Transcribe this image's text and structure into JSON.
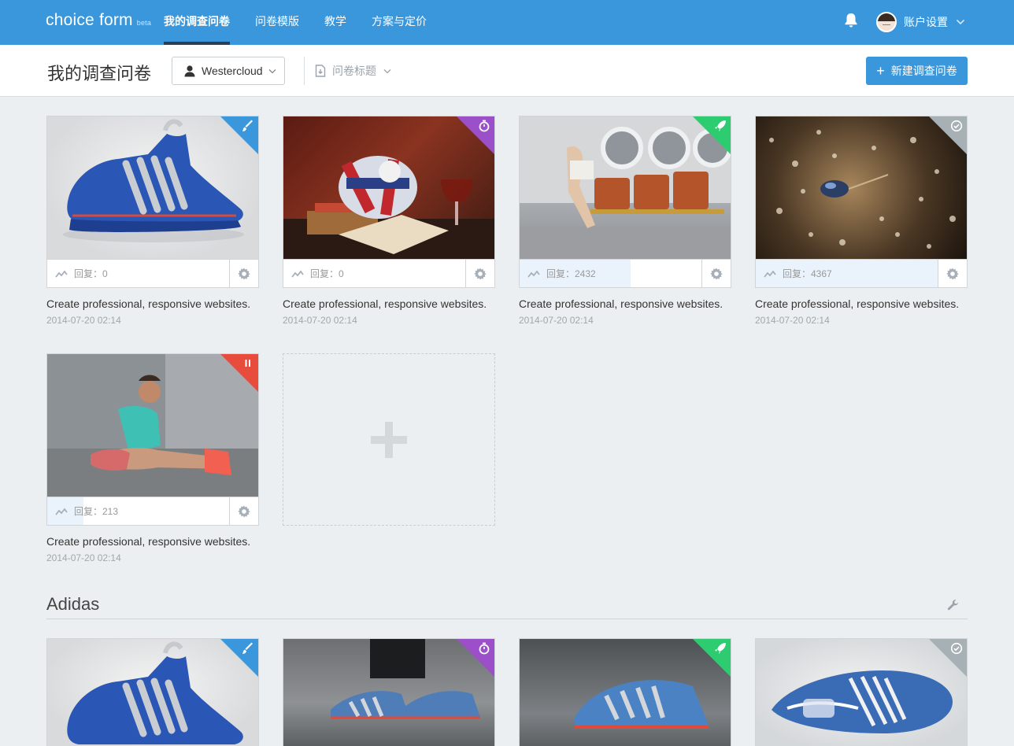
{
  "nav": {
    "logo": "choice form",
    "logo_beta": "beta",
    "items": [
      {
        "label": "我的调查问卷",
        "active": true
      },
      {
        "label": "问卷模版",
        "active": false
      },
      {
        "label": "教学",
        "active": false
      },
      {
        "label": "方案与定价",
        "active": false
      }
    ],
    "account_label": "账户设置"
  },
  "header": {
    "title": "我的调查问卷",
    "owner": "Westercloud",
    "sort_label": "问卷标题",
    "new_button": "新建调查问卷"
  },
  "colors": {
    "brand": "#3a97dc",
    "badge_blue": "#3a97dc",
    "badge_purple": "#9b4fc8",
    "badge_green": "#2ecc71",
    "badge_gray": "#a6b0b5",
    "badge_red": "#e74c3c"
  },
  "surveys": [
    {
      "title": "Create professional, responsive websites.",
      "date": "2014-07-20 02:14",
      "replies": "回复：0",
      "reply_fraction": 0,
      "status_icon": "brush-icon",
      "status_color": "#3a97dc",
      "image": "blue-sneaker"
    },
    {
      "title": "Create professional, responsive websites.",
      "date": "2014-07-20 02:14",
      "replies": "回复：0",
      "reply_fraction": 0,
      "status_icon": "timer-icon",
      "status_color": "#9b4fc8",
      "image": "union-jack-bulldog"
    },
    {
      "title": "Create professional, responsive websites.",
      "date": "2014-07-20 02:14",
      "replies": "回复：2432",
      "reply_fraction": 0.61,
      "status_icon": "rocket-icon",
      "status_color": "#2ecc71",
      "image": "laundromat-woman"
    },
    {
      "title": "Create professional, responsive websites.",
      "date": "2014-07-20 02:14",
      "replies": "回复：4367",
      "reply_fraction": 1,
      "status_icon": "check-icon",
      "status_color": "#a6b0b5",
      "image": "beetle-dewdrops"
    },
    {
      "title": "Create professional, responsive websites.",
      "date": "2014-07-20 02:14",
      "replies": "回复：213",
      "reply_fraction": 0.2,
      "status_icon": "pause-icon",
      "status_color": "#e74c3c",
      "image": "athlete-stretching"
    }
  ],
  "group": {
    "name": "Adidas",
    "cards": [
      {
        "status_icon": "brush-icon",
        "status_color": "#3a97dc",
        "image": "blue-sneaker"
      },
      {
        "status_icon": "timer-icon",
        "status_color": "#9b4fc8",
        "image": "sneakers-on-feet"
      },
      {
        "status_icon": "rocket-icon",
        "status_color": "#2ecc71",
        "image": "sneaker-closeup"
      },
      {
        "status_icon": "check-icon",
        "status_color": "#a6b0b5",
        "image": "sneaker-topview"
      }
    ]
  }
}
